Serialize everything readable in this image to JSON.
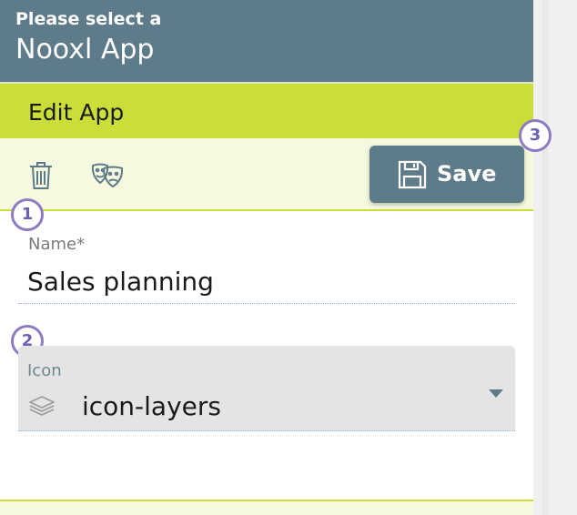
{
  "header": {
    "subtitle": "Please select a",
    "title": "Nooxl App"
  },
  "edit_bar": {
    "label": "Edit App"
  },
  "toolbar": {
    "delete_icon": "trash-icon",
    "theme_icon": "theater-masks-icon",
    "save_label": "Save",
    "save_icon": "floppy-disk-icon"
  },
  "badges": [
    "1",
    "2",
    "3"
  ],
  "form": {
    "name": {
      "label": "Name*",
      "value": "Sales planning"
    },
    "icon": {
      "label": "Icon",
      "value": "icon-layers",
      "icon": "layers-icon"
    }
  },
  "colors": {
    "header": "#5d7b88",
    "accent": "#cbdd38",
    "toolbar_bg": "#f6f9df",
    "badge_border": "#8e7cc3"
  }
}
